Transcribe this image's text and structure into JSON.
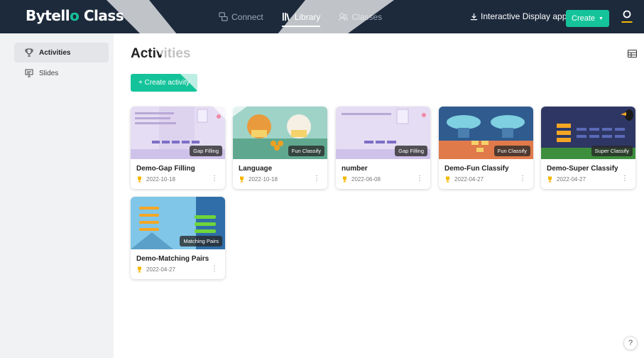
{
  "brand": {
    "name_a": "Bytell",
    "name_b": "o",
    "name_c": " Class"
  },
  "nav": {
    "items": [
      {
        "label": "Connect",
        "icon": "connect-icon"
      },
      {
        "label": "Library",
        "icon": "library-icon"
      },
      {
        "label": "Classes",
        "icon": "classes-icon"
      }
    ],
    "active": "Library"
  },
  "header": {
    "interactive_display": "Interactive Display app",
    "create_label": "Create"
  },
  "sidebar": {
    "items": [
      {
        "label": "Activities",
        "icon": "trophy-icon",
        "active": true
      },
      {
        "label": "Slides",
        "icon": "presentation-icon",
        "active": false
      }
    ]
  },
  "main": {
    "title": "Activities",
    "create_activity_label": "+ Create activity"
  },
  "cards": [
    {
      "title": "Demo-Gap Filling",
      "date": "2022-10-18",
      "type": "Gap Filling"
    },
    {
      "title": "Language",
      "date": "2022-10-18",
      "type": "Fun Classify"
    },
    {
      "title": "number",
      "date": "2022-06-08",
      "type": "Gap Filling"
    },
    {
      "title": "Demo-Fun Classify",
      "date": "2022-04-27",
      "type": "Fun Classify"
    },
    {
      "title": "Demo-Super Classify",
      "date": "2022-04-27",
      "type": "Super Classify"
    },
    {
      "title": "Demo-Matching Pairs",
      "date": "2022-04-27",
      "type": "Matching Pairs"
    }
  ],
  "help": {
    "label": "?"
  },
  "colors": {
    "topbar": "#1d2a3c",
    "accent": "#15c39a",
    "sidebar": "#f1f2f4",
    "trophy": "#f5b800"
  }
}
